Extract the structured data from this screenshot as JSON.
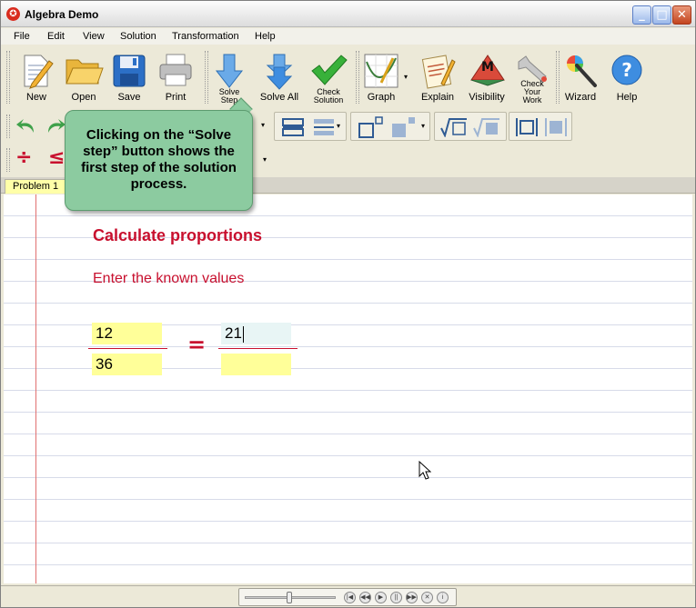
{
  "window": {
    "title": "Algebra Demo",
    "minimize_glyph": "_",
    "maximize_glyph": "□",
    "close_glyph": "✕"
  },
  "menu": [
    "File",
    "Edit",
    "View",
    "Solution",
    "Transformation",
    "Help"
  ],
  "toolbar": {
    "new": "New",
    "open": "Open",
    "save": "Save",
    "print": "Print",
    "solve_step": "Solve Step",
    "solve_all": "Solve All",
    "check_solution": "Check Solution",
    "graph": "Graph",
    "explain": "Explain",
    "visibility": "Visibility",
    "visibility_badge": "M",
    "check_your_work": "Check Your Work",
    "wizard": "Wizard",
    "help": "Help",
    "help_glyph": "?"
  },
  "math_toolbar": {
    "divide": "÷",
    "less_equal": "≤"
  },
  "tabs": {
    "problem": "Problem 1"
  },
  "worksheet": {
    "heading": "Calculate proportions",
    "instruction": "Enter the known values",
    "left_numerator": "12",
    "left_denominator": "36",
    "equals": "=",
    "right_numerator": "21",
    "right_denominator": ""
  },
  "tooltip": {
    "text": "Clicking on the “Solve step” button shows the first step of the solution process."
  },
  "player": {
    "buttons": [
      "|◀",
      "◀◀",
      "▶",
      "||",
      "▶▶",
      "✕",
      "i"
    ]
  },
  "colors": {
    "accent_red": "#c8102e",
    "input_yellow": "#ffff99",
    "tooltip_green": "#8ccba0",
    "toolbar_blue": "#3e8de0"
  }
}
